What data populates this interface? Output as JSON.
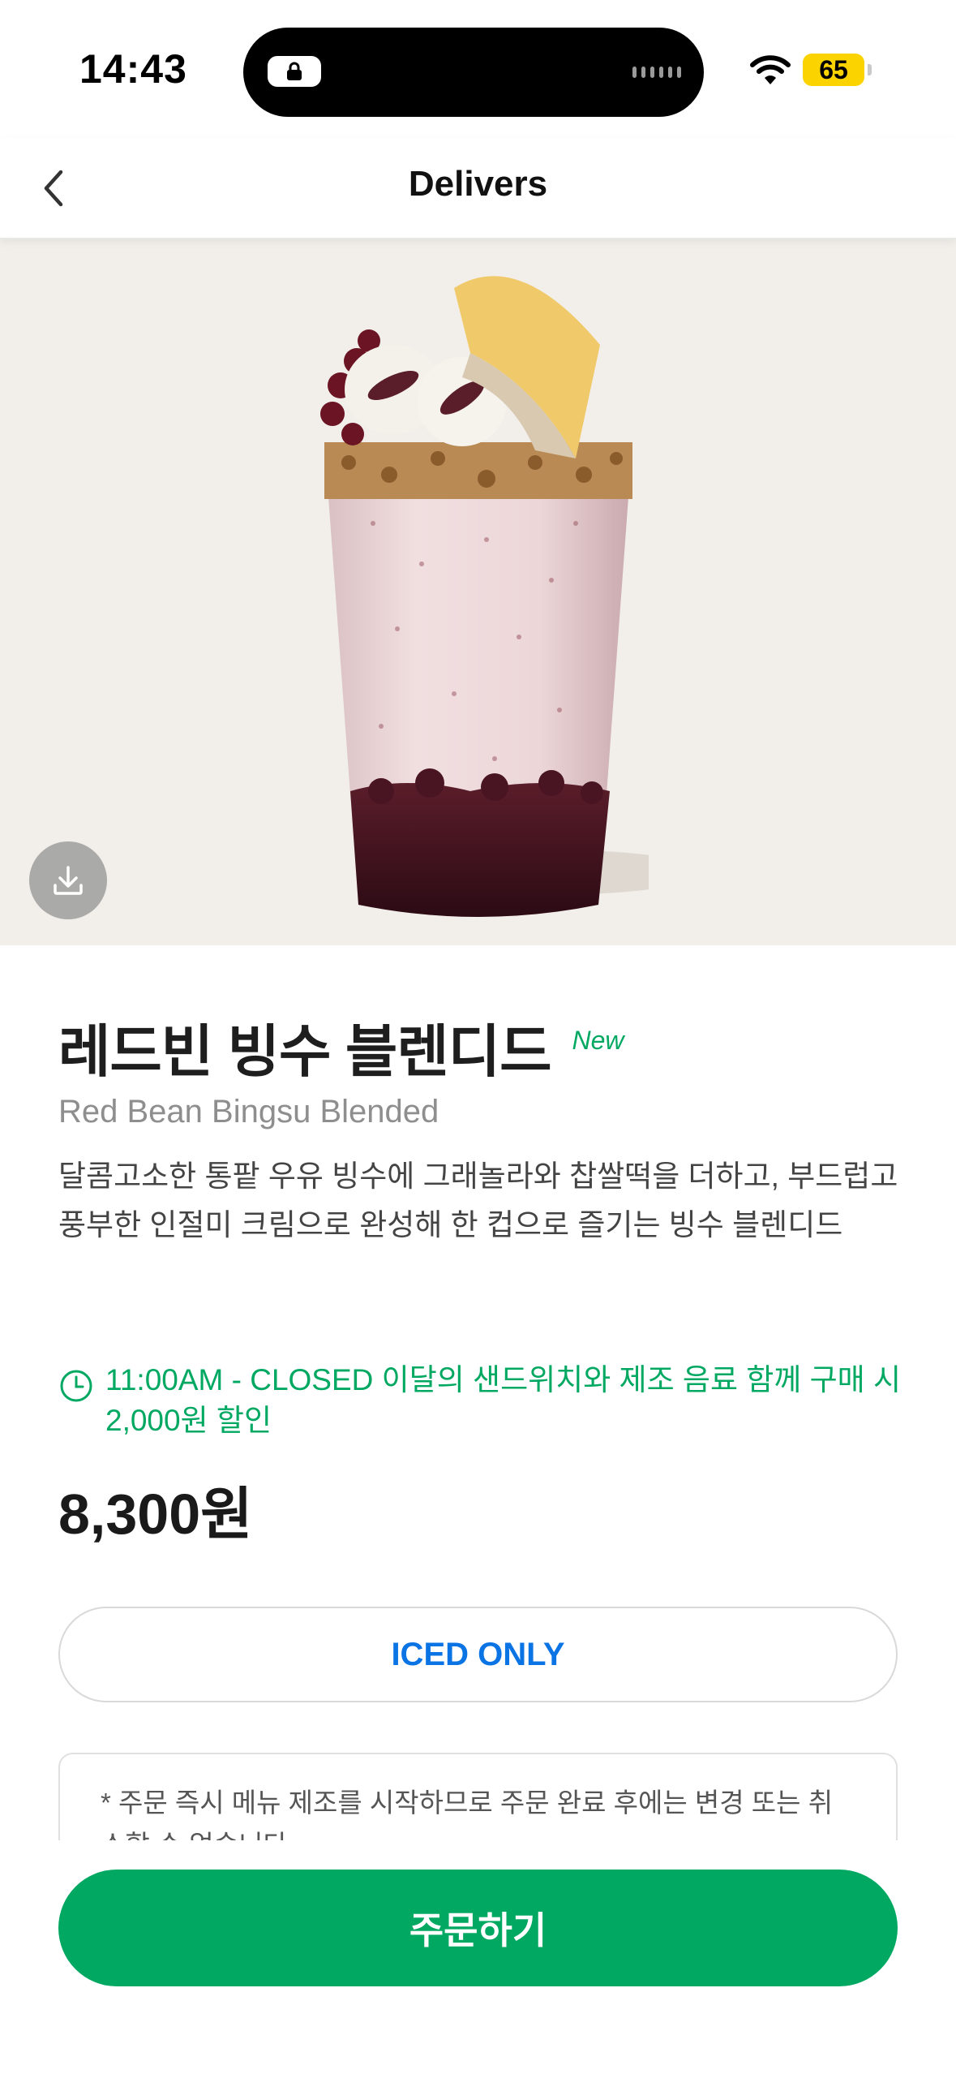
{
  "status_bar": {
    "time": "14:43",
    "battery": "65"
  },
  "nav": {
    "title": "Delivers",
    "back_icon": "chevron-left-icon"
  },
  "hero": {
    "download_icon": "download-icon"
  },
  "product": {
    "name": "레드빈 빙수 블렌디드",
    "badge": "New",
    "name_en": "Red Bean Bingsu Blended",
    "description": "달콤고소한 통팥 우유 빙수에 그래놀라와 찹쌀떡을 더하고, 부드럽고 풍부한 인절미 크림으로 완성해 한 컵으로 즐기는 빙수 블렌디드",
    "promo": "11:00AM - CLOSED 이달의 샌드위치와 제조 음료 함께 구매 시 2,000원 할인",
    "price": "8,300원",
    "temperature_option": "ICED ONLY",
    "notice": "* 주문 즉시 메뉴 제조를 시작하므로 주문 완료 후에는 변경 또는 취소할 수 없습니다."
  },
  "actions": {
    "order_label": "주문하기"
  },
  "colors": {
    "brand_green": "#00a862",
    "iced_blue": "#0b74e5",
    "battery_yellow": "#fbd400"
  }
}
